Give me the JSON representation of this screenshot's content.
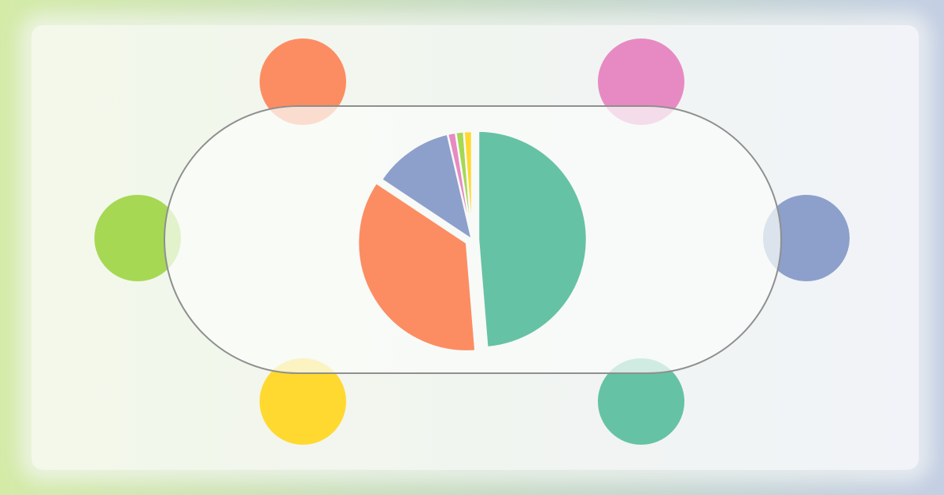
{
  "colors": {
    "background_left": "#d4eba8",
    "background_right": "#c4cfe4",
    "table_outline": "#8f8f8f"
  },
  "seats": [
    {
      "name": "seat-top-left",
      "color": "#fc8d62"
    },
    {
      "name": "seat-top-right",
      "color": "#e78ac3"
    },
    {
      "name": "seat-middle-left",
      "color": "#a6d854"
    },
    {
      "name": "seat-middle-right",
      "color": "#8da0cb"
    },
    {
      "name": "seat-bottom-left",
      "color": "#ffd92f"
    },
    {
      "name": "seat-bottom-right",
      "color": "#66c2a5"
    }
  ],
  "chart_data": {
    "type": "pie",
    "title": "",
    "legend": "none",
    "slices": [
      {
        "value": 48.5,
        "color": "#66c2a5",
        "exploded": true
      },
      {
        "value": 35.5,
        "color": "#fc8d62",
        "exploded": true
      },
      {
        "value": 12.0,
        "color": "#8da0cb",
        "exploded": false
      },
      {
        "value": 1.2,
        "color": "#e78ac3",
        "exploded": false
      },
      {
        "value": 1.2,
        "color": "#a6d854",
        "exploded": false
      },
      {
        "value": 1.2,
        "color": "#ffd92f",
        "exploded": false
      }
    ]
  }
}
